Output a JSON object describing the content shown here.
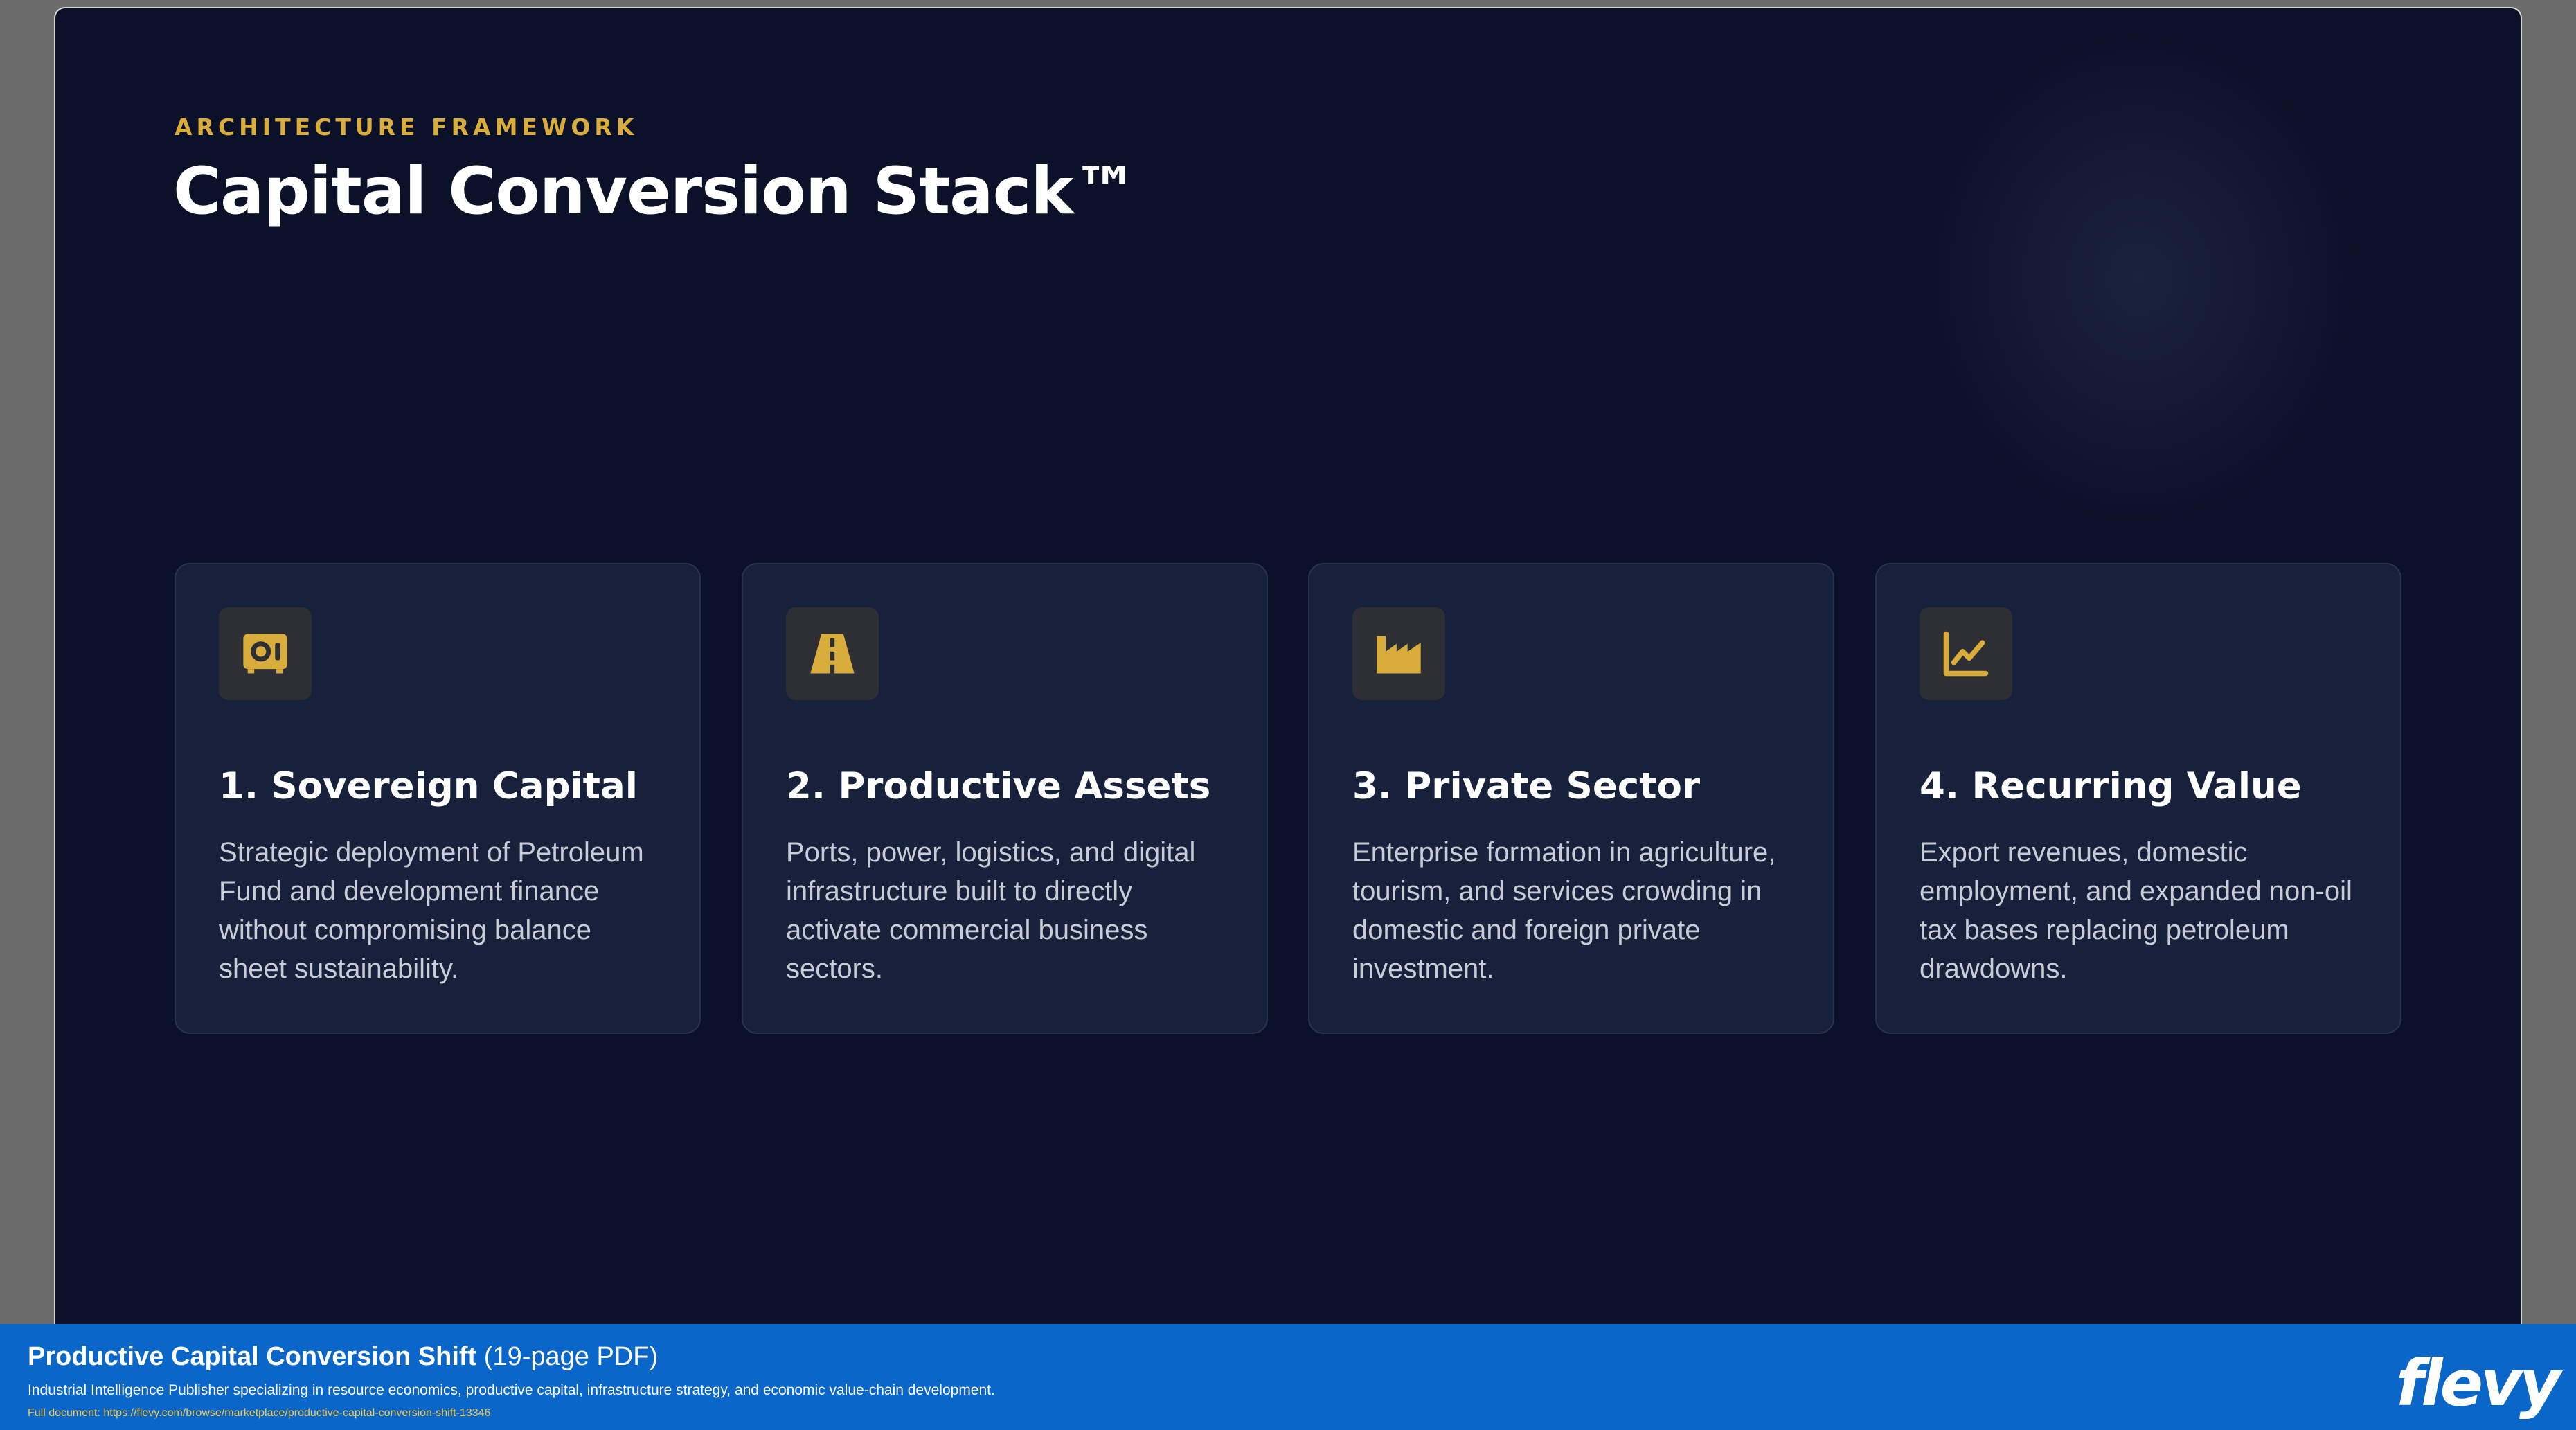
{
  "slide": {
    "eyebrow": "ARCHITECTURE FRAMEWORK",
    "title": "Capital Conversion Stack™",
    "accent_color": "#d9ad3b",
    "background_color": "#0b1128",
    "cards": [
      {
        "icon": "vault-icon",
        "title": "1. Sovereign Capital",
        "description": "Strategic deployment of Petroleum Fund and development finance without compromising balance sheet sustainability."
      },
      {
        "icon": "road-icon",
        "title": "2. Productive Assets",
        "description": "Ports, power, logistics, and digital infrastructure built to directly activate commercial business sectors."
      },
      {
        "icon": "factory-icon",
        "title": "3. Private Sector",
        "description": "Enterprise formation in agriculture, tourism, and services crowding in domestic and foreign private investment."
      },
      {
        "icon": "chart-line-icon",
        "title": "4. Recurring Value",
        "description": "Export revenues, domestic employment, and expanded non-oil tax bases replacing petroleum drawdowns."
      }
    ]
  },
  "banner": {
    "title_strong": "Productive Capital Conversion Shift",
    "title_suffix": " (19-page PDF)",
    "subtitle": "Industrial Intelligence Publisher specializing in resource economics, productive capital, infrastructure strategy, and economic value-chain development.",
    "link": "Full document: https://flevy.com/browse/marketplace/productive-capital-conversion-shift-13346",
    "logo": "flevy",
    "background_color": "#0a66c8"
  }
}
